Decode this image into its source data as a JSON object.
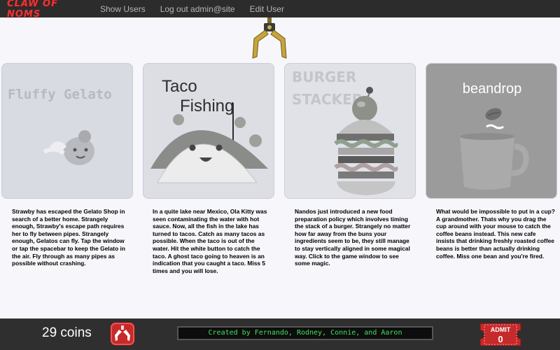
{
  "navbar": {
    "brand": "CLAW OF NOMS",
    "links": [
      "Show Users",
      "Log out admin@site",
      "Edit User"
    ]
  },
  "games": [
    {
      "title": "Fluffy Gelato",
      "description": "Strawby has escaped the Gelato Shop in search of a better home. Strangely enough, Strawby's escape path requires her to fly between pipes. Strangely enough, Gelatos can fly. Tap the window or tap the spacebar to keep the Gelato in the air. Fly through as many pipes as possible without crashing."
    },
    {
      "title_line1": "Taco",
      "title_line2": "Fishing",
      "description": "In a quite lake near Mexico, Ola Kitty was seen contaminating the water with hot sauce. Now, all the fish in the lake has turned to tacos. Catch as many tacos as possible. When the taco is out of the water. Hit the white button to catch the taco. A ghost taco going to heaven is an indication that you caught a taco. Miss 5 times and you will lose."
    },
    {
      "title_line1": "BURGER",
      "title_line2": "STACKER",
      "description": "Nandos just introduced a new food preparation policy which involves timing the stack of a burger. Strangely no matter how far away from the buns your ingredients seem to be, they still manage to stay vertically aligned in some magical way. Click to the game window to see some magic."
    },
    {
      "title": "beandrop",
      "description": "What would be impossible to put in a cup? A grandmother. Thats why you drag the cup around with your mouse to catch the coffee beans instead. This new cafe insists that drinking freshly roasted coffee beans is better than actually drinking coffee. Miss one bean and you're fired."
    }
  ],
  "footer": {
    "coins": "29 coins",
    "credits": "Created by Fernando, Rodney, Connie, and Aaron",
    "ticket_label": "ADMIT",
    "ticket_count": "0"
  },
  "icons": {
    "claw": "claw-icon",
    "claw_button": "claw-button-icon",
    "ticket": "admit-ticket-icon"
  },
  "colors": {
    "navbar": "#2c2c2c",
    "brand": "#e23a3a",
    "credits_text": "#43e05a",
    "ticket": "#c62a2a"
  }
}
